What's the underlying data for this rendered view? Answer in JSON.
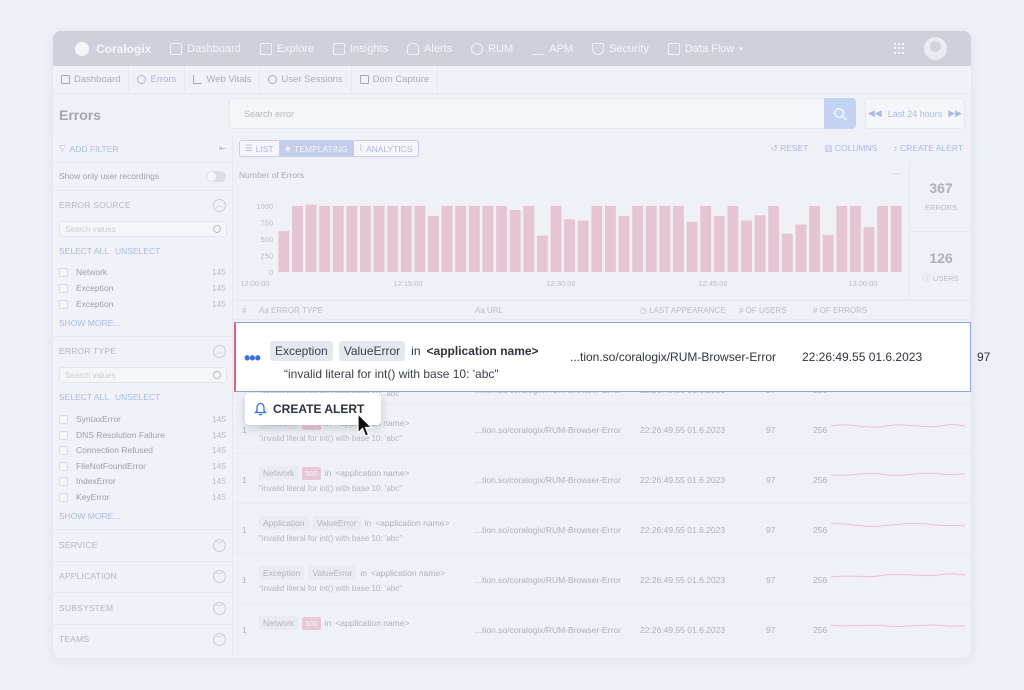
{
  "topbar": {
    "brand": "Coralogix",
    "nav": [
      {
        "label": "Dashboard",
        "icon": "dashboard-icon"
      },
      {
        "label": "Explore",
        "icon": "explore-icon"
      },
      {
        "label": "Insights",
        "icon": "insights-icon"
      },
      {
        "label": "Alerts",
        "icon": "bell-icon"
      },
      {
        "label": "RUM",
        "icon": "rum-icon"
      },
      {
        "label": "APM",
        "icon": "apm-icon"
      },
      {
        "label": "Security",
        "icon": "shield-icon"
      },
      {
        "label": "Data Flow",
        "icon": "data-flow-icon"
      }
    ]
  },
  "tabs": [
    "Dashboard",
    "Errors",
    "Web Vitals",
    "User Sessions",
    "Dom Capture"
  ],
  "active_tab": "Errors",
  "page_title": "Errors",
  "search": {
    "placeholder": "Search error"
  },
  "time_range": "Last 24 hours",
  "sidebar": {
    "add_filter": "ADD FILTER",
    "user_recordings": "Show only user recordings",
    "select_all": "SELECT ALL",
    "unselect": "UNSELECT",
    "show_more": "SHOW MORE...",
    "search_placeholder": "Search values",
    "error_source": {
      "title": "ERROR SOURCE",
      "items": [
        {
          "label": "Network",
          "count": "145"
        },
        {
          "label": "Exception",
          "count": "145"
        },
        {
          "label": "Exception",
          "count": "145"
        }
      ]
    },
    "error_type": {
      "title": "ERROR TYPE",
      "items": [
        {
          "label": "SyntaxError",
          "count": "145"
        },
        {
          "label": "DNS Resolution Failure",
          "count": "145"
        },
        {
          "label": "Connection Refused",
          "count": "145"
        },
        {
          "label": "FileNotFoundError",
          "count": "145"
        },
        {
          "label": "IndexError",
          "count": "145"
        },
        {
          "label": "KeyError",
          "count": "145"
        }
      ]
    },
    "collapsed": [
      "SERVICE",
      "APPLICATION",
      "SUBSYSTEM",
      "TEAMS"
    ]
  },
  "toolbar": {
    "views": [
      "LIST",
      "TEMPLATING",
      "ANALYTICS"
    ],
    "active_view": "TEMPLATING",
    "reset": "RESET",
    "columns": "COLUMNS",
    "create_alert": "CREATE ALERT"
  },
  "stats": {
    "errors": "367",
    "errors_label": "ERRORS",
    "users": "126",
    "users_label": "USERS"
  },
  "chart_data": {
    "type": "bar",
    "title": "Number of Errors",
    "y_ticks": [
      "1000",
      "750",
      "500",
      "250",
      "0"
    ],
    "x_ticks": [
      "12:00:00",
      "12:15:00",
      "12:30:00",
      "12:45:00",
      "13:00:00"
    ],
    "ylim": [
      0,
      1000
    ],
    "values": [
      620,
      1000,
      1020,
      1000,
      1000,
      1000,
      1000,
      1000,
      1000,
      1000,
      1000,
      850,
      1000,
      1000,
      1000,
      1000,
      1000,
      940,
      1000,
      550,
      1000,
      800,
      780,
      1000,
      1000,
      850,
      1000,
      1000,
      1000,
      1000,
      760,
      1000,
      850,
      1000,
      780,
      860,
      1000,
      580,
      720,
      1000,
      560,
      1000,
      1000,
      680,
      1000,
      1000
    ],
    "color": "#dd93aa"
  },
  "table": {
    "headers": [
      "#",
      "ERROR TYPE",
      "URL",
      "LAST APPEARANCE",
      "OF USERS",
      "OF ERRORS"
    ],
    "highlighted": {
      "tags": [
        "Exception",
        "ValueError"
      ],
      "in": "in",
      "app": "<application name>",
      "message": "“invalid literal for int() with base 10: 'abc\"",
      "url": "...tion.so/coralogix/RUM-Browser-Error",
      "time": "22:26:49.55 01.6.2023",
      "users": "97"
    },
    "rows": [
      {
        "num": "1",
        "tags": [
          "Network"
        ],
        "code": "500",
        "in": "in",
        "app": "<application name>",
        "message": "“invalid literal for int() with base 10: 'abc\"",
        "url": "...tion.so/coralogix/RUM-Browser-Error",
        "time": "22:26:49.55 01.6.2023",
        "users": "97",
        "errors": "256"
      },
      {
        "num": "1",
        "tags": [
          "Network"
        ],
        "code": "500",
        "in": "in",
        "app": "<application name>",
        "message": "“invalid literal for int() with base 10: 'abc\"",
        "url": "...tion.so/coralogix/RUM-Browser-Error",
        "time": "22:26:49.55 01.6.2023",
        "users": "97",
        "errors": "256"
      },
      {
        "num": "1",
        "tags": [
          "Application",
          "ValueError"
        ],
        "code": "",
        "in": "in",
        "app": "<application name>",
        "message": "“invalid literal for int() with base 10: 'abc\"",
        "url": "...tion.so/coralogix/RUM-Browser-Error",
        "time": "22:26:49.55 01.6.2023",
        "users": "97",
        "errors": "256"
      },
      {
        "num": "1",
        "tags": [
          "Exception",
          "ValueError"
        ],
        "code": "",
        "in": "in",
        "app": "<application name>",
        "message": "“invalid literal for int() with base 10: 'abc\"",
        "url": "...tion.so/coralogix/RUM-Browser-Error",
        "time": "22:26:49.55 01.6.2023",
        "users": "97",
        "errors": "256"
      },
      {
        "num": "1",
        "tags": [
          "Network"
        ],
        "code": "500",
        "in": "in",
        "app": "<application name>",
        "message": "",
        "url": "...tion.so/coralogix/RUM-Browser-Error",
        "time": "22:26:49.55 01.6.2023",
        "users": "97",
        "errors": "256"
      }
    ],
    "partial_row": {
      "message": "“invalid literal for int() with base 10: 'abc\"",
      "url": "...tion.so/coralogix/RUM-Browser-Error",
      "time": "22:26:49.55 01.6.2023",
      "users": "97",
      "errors": "256"
    }
  },
  "popup": {
    "label": "CREATE ALERT"
  }
}
